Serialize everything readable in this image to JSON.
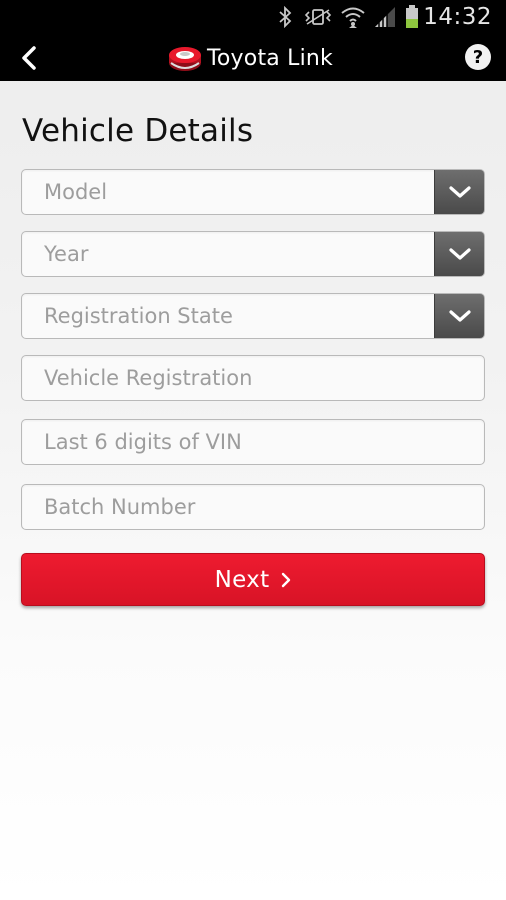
{
  "status_bar": {
    "time": "14:32",
    "icons": [
      "bluetooth-icon",
      "vibrate-icon",
      "wifi-icon",
      "signal-icon",
      "battery-icon"
    ]
  },
  "app_bar": {
    "title": "Toyota Link",
    "back_icon": "chevron-left-icon",
    "help_label": "?"
  },
  "page": {
    "title": "Vehicle Details"
  },
  "form": {
    "model": {
      "placeholder": "Model"
    },
    "year": {
      "placeholder": "Year"
    },
    "registration_state": {
      "placeholder": "Registration State"
    },
    "vehicle_registration": {
      "placeholder": "Vehicle Registration"
    },
    "vin": {
      "placeholder": "Last 6 digits of VIN"
    },
    "batch_number": {
      "placeholder": "Batch Number"
    }
  },
  "next_button": {
    "label": "Next"
  },
  "colors": {
    "accent": "#e8192c",
    "bar": "#000000",
    "placeholder": "#9d9d9d",
    "dropdown": "#555555",
    "battery": "#8ec63f"
  }
}
